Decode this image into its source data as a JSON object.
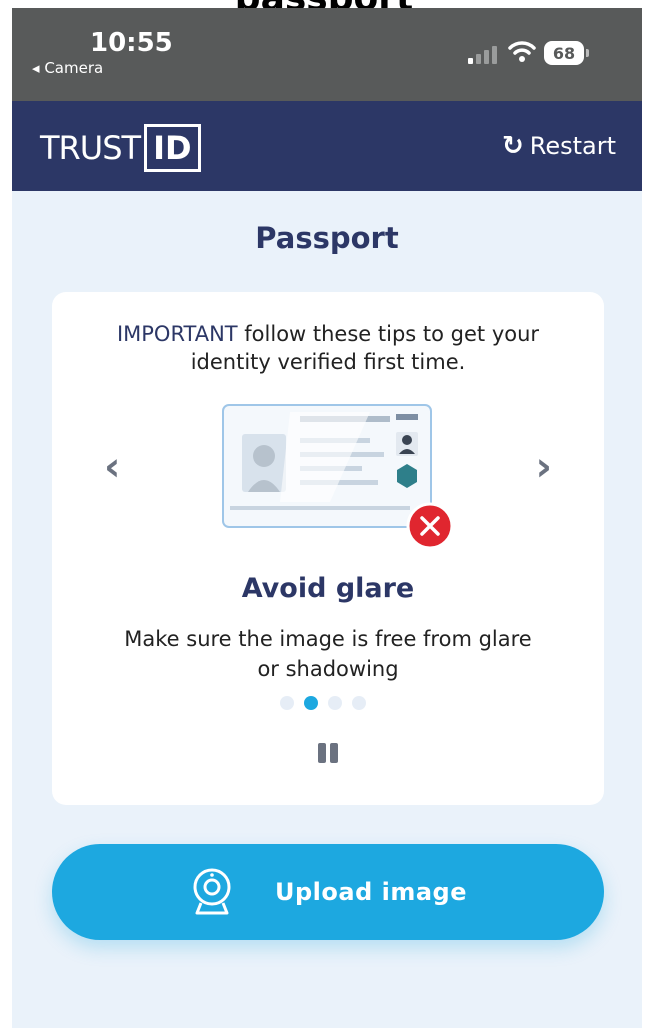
{
  "top_clipped_text": "passport",
  "status_bar": {
    "time": "10:55",
    "back_app": "Camera",
    "battery": "68"
  },
  "header": {
    "logo_trust": "TRUST",
    "logo_id": "ID",
    "restart_label": "Restart"
  },
  "page": {
    "title": "Passport"
  },
  "tips": {
    "intro_important": "IMPORTANT",
    "intro_rest": " follow these tips to get your identity verified first time.",
    "current_title": "Avoid glare",
    "current_description": "Make sure the image is free from glare or shadowing",
    "page_count": 4,
    "active_index": 1
  },
  "upload": {
    "label": "Upload image"
  },
  "colors": {
    "navy": "#2c3766",
    "accent_blue": "#1da8e0",
    "error_red": "#e0262f",
    "page_bg": "#eaf2fa"
  },
  "icons": [
    "restart-icon",
    "chevron-left-icon",
    "chevron-right-icon",
    "error-x-icon",
    "pause-icon",
    "webcam-icon"
  ]
}
